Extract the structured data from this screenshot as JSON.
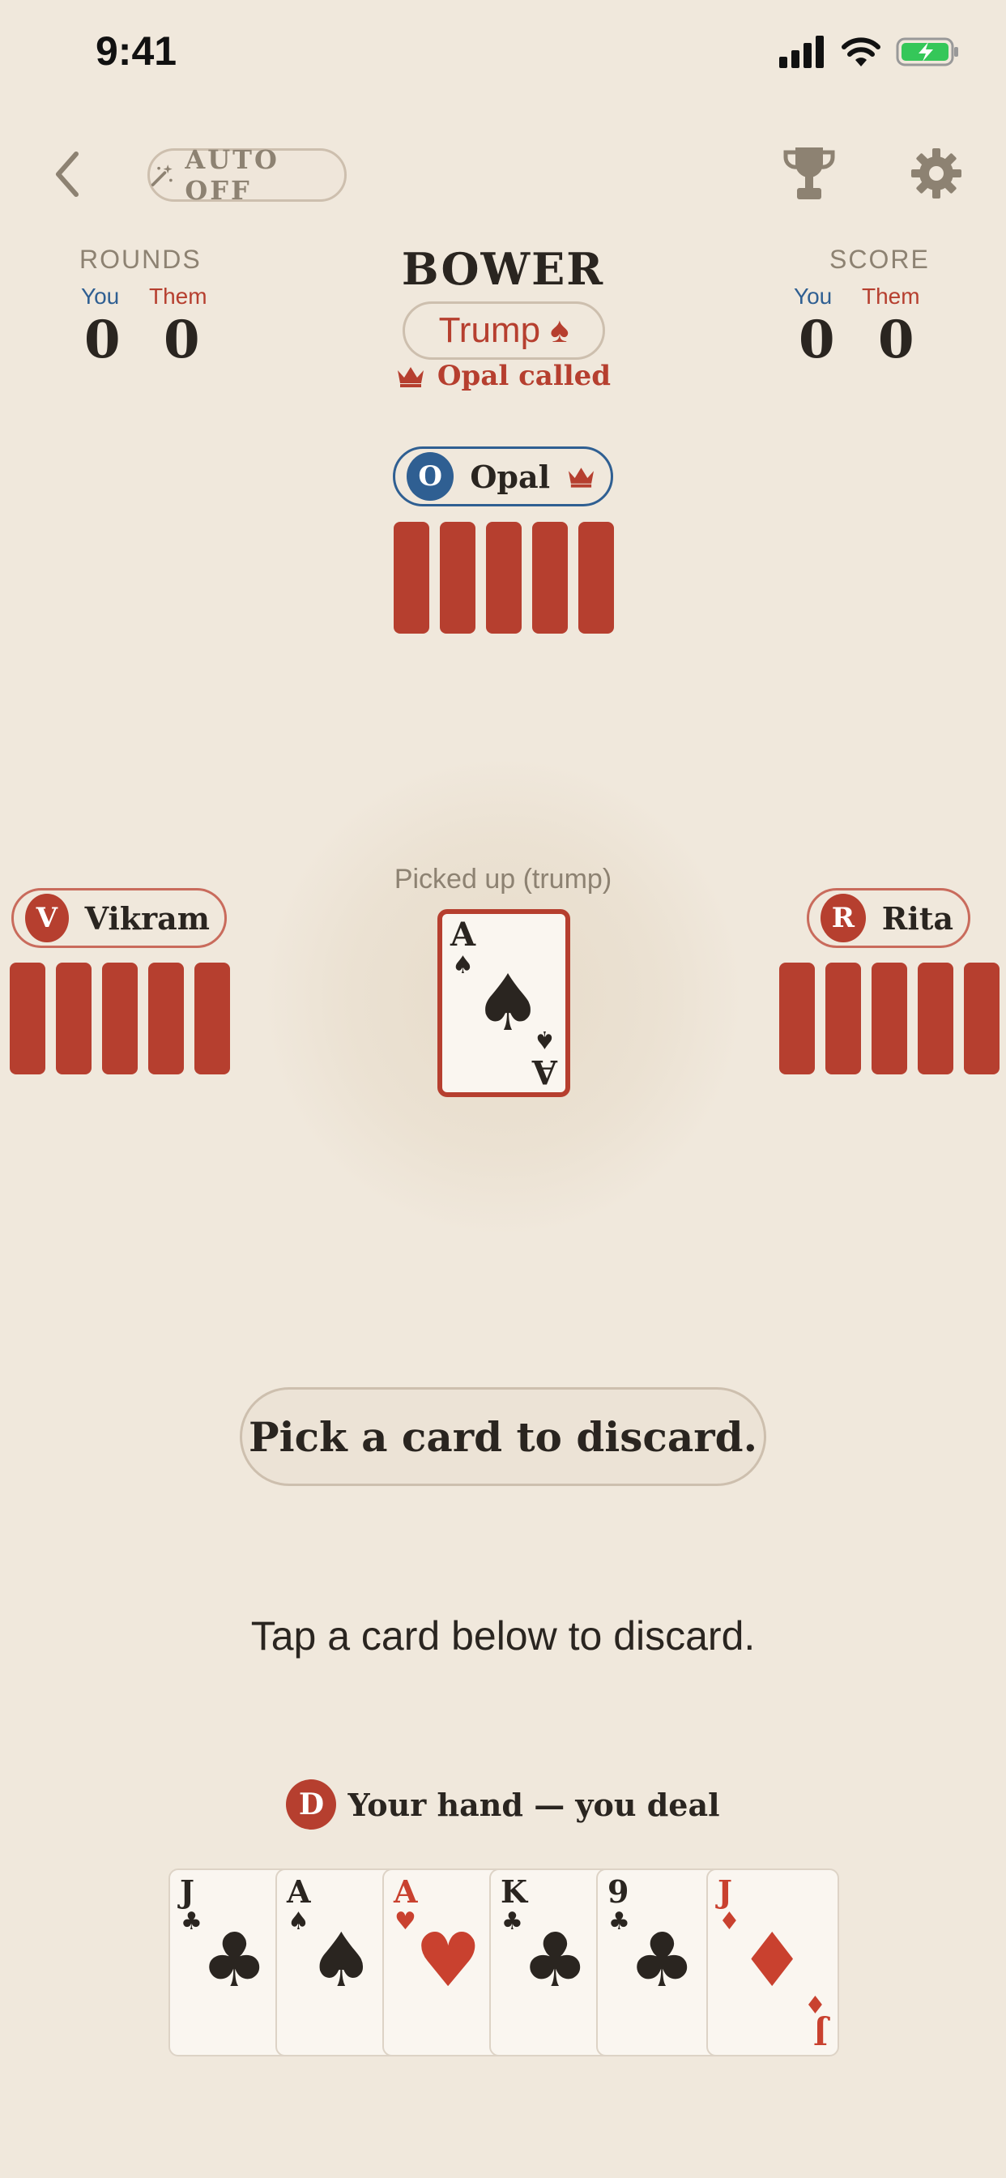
{
  "status_bar": {
    "time": "9:41"
  },
  "header": {
    "auto_label": "AUTO OFF",
    "icons": [
      "chevron-left-icon",
      "magic-wand-icon",
      "trophy-icon",
      "gear-icon"
    ]
  },
  "rounds": {
    "title": "ROUNDS",
    "you_label": "You",
    "them_label": "Them",
    "you": "0",
    "them": "0"
  },
  "score": {
    "title": "SCORE",
    "you_label": "You",
    "them_label": "Them",
    "you": "0",
    "them": "0"
  },
  "game": {
    "title": "BOWER",
    "trump_label": "Trump",
    "trump_suit": "♠",
    "called_text": "Opal called"
  },
  "players": {
    "top": {
      "initial": "O",
      "name": "Opal",
      "cards": 5,
      "color": "#2f5f92",
      "is_caller": true
    },
    "left": {
      "initial": "V",
      "name": "Vikram",
      "cards": 5,
      "color": "#b63f2f"
    },
    "right": {
      "initial": "R",
      "name": "Rita",
      "cards": 5,
      "color": "#b63f2f"
    }
  },
  "center": {
    "picked_label": "Picked up (trump)",
    "card": {
      "rank": "A",
      "suit": "♠",
      "color": "#2a2520"
    }
  },
  "prompt": "Pick a card to discard.",
  "instruction": "Tap a card below to discard.",
  "hand": {
    "dealer_initial": "D",
    "label": "Your hand — you deal",
    "cards": [
      {
        "rank": "J",
        "suit": "♣",
        "color": "#2a2520"
      },
      {
        "rank": "A",
        "suit": "♠",
        "color": "#2a2520"
      },
      {
        "rank": "A",
        "suit": "♥",
        "color": "#c9412f"
      },
      {
        "rank": "K",
        "suit": "♣",
        "color": "#2a2520"
      },
      {
        "rank": "9",
        "suit": "♣",
        "color": "#2a2520"
      },
      {
        "rank": "J",
        "suit": "♦",
        "color": "#c9412f"
      }
    ]
  },
  "colors": {
    "background": "#f0e8dc",
    "accent_red": "#b63f2f",
    "accent_blue": "#2f5f92",
    "muted": "#8d8272"
  }
}
